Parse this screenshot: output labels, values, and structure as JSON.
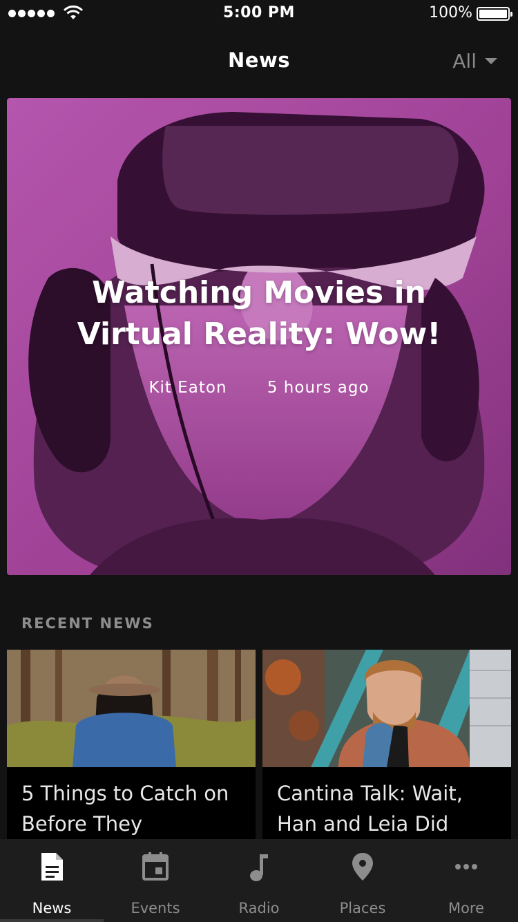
{
  "status_bar": {
    "time": "5:00 PM",
    "battery_percent": "100%",
    "signal_bars": 5,
    "icons": [
      "signal-icon",
      "wifi-icon",
      "battery-icon"
    ]
  },
  "header": {
    "title": "News",
    "filter_label": "All",
    "filter_icon": "caret-down-icon"
  },
  "hero": {
    "title": "Watching Movies in Virtual Reality: Wow!",
    "author": "Kit Eaton",
    "time_ago": "5 hours ago",
    "tint_color": "#b04aa8"
  },
  "recent": {
    "label": "RECENT NEWS",
    "items": [
      {
        "title": "5 Things to Catch on Before They"
      },
      {
        "title": "Cantina Talk: Wait, Han and Leia Did"
      }
    ]
  },
  "tabs": [
    {
      "label": "News",
      "icon": "document-icon",
      "active": true
    },
    {
      "label": "Events",
      "icon": "calendar-icon",
      "active": false
    },
    {
      "label": "Radio",
      "icon": "music-note-icon",
      "active": false
    },
    {
      "label": "Places",
      "icon": "map-pin-icon",
      "active": false
    },
    {
      "label": "More",
      "icon": "more-dots-icon",
      "active": false
    }
  ],
  "colors": {
    "background": "#131313",
    "tabbar": "#1d1d1d",
    "muted_text": "#8d8d8d"
  }
}
